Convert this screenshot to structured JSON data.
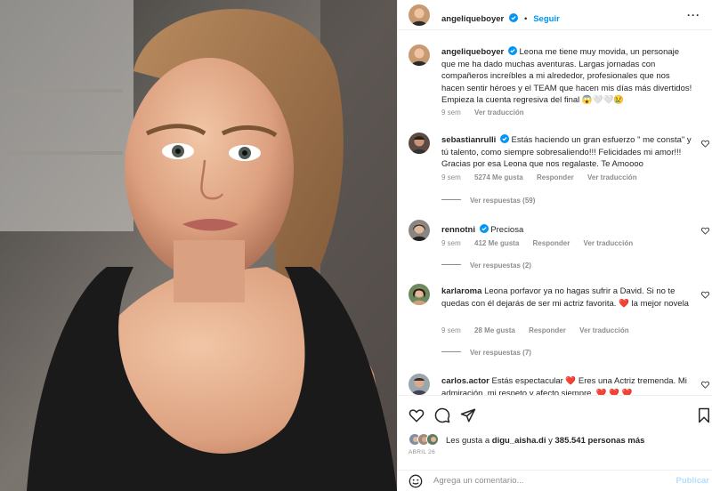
{
  "post": {
    "author": "angeliqueboyer",
    "follow_label": "Seguir",
    "more_icon": "more-dots-icon",
    "photo": "selfie-woman-black-top-braid"
  },
  "caption": {
    "username": "angeliqueboyer",
    "text": "Leona me tiene muy movida, un personaje que me ha dado muchas aventuras. Largas jornadas con compañeros increíbles a mi alrededor, profesionales que nos hacen sentir héroes y el TEAM que hacen mis días más divertidos! Empieza la cuenta regresiva del final 😱🤍🤍😢",
    "time": "9 sem",
    "translate": "Ver traducción"
  },
  "comments": [
    {
      "username": "sebastianrulli",
      "verified": true,
      "text": "Estás haciendo un gran esfuerzo \" me consta\" y tú talento, como siempre sobresaliendo!!! Felicidades mi amor!!! Gracias por esa Leona que nos regalaste. Te Amoooo",
      "time": "9 sem",
      "likes": "5274 Me gusta",
      "reply": "Responder",
      "translate": "Ver traducción",
      "replies": "Ver respuestas (59)"
    },
    {
      "username": "rennotni",
      "verified": true,
      "text": "Preciosa",
      "time": "9 sem",
      "likes": "412 Me gusta",
      "reply": "Responder",
      "translate": "Ver traducción",
      "replies": "Ver respuestas (2)"
    },
    {
      "username": "karlaroma",
      "verified": false,
      "text": "Leona porfavor ya no hagas sufrir a David. Si no te quedas con él dejarás de ser mi actriz favorita. ❤️ la mejor novela",
      "time": "9 sem",
      "likes": "28 Me gusta",
      "reply": "Responder",
      "translate": "Ver traducción",
      "replies": "Ver respuestas (7)"
    },
    {
      "username": "carlos.actor",
      "verified": false,
      "text": "Estás espectacular ❤️ Eres una Actriz tremenda. Mi admiración, mi respeto y afecto siempre. ❤️ ❤️ ❤️",
      "time": "",
      "likes": "",
      "reply": "",
      "translate": "",
      "replies": ""
    }
  ],
  "likes_summary": {
    "prefix": "Les gusta a",
    "user": "digu_aisha.di",
    "middle": "y",
    "count": "385.541 personas más"
  },
  "date": "ABRIL 26",
  "add_comment": {
    "placeholder": "Agrega un comentario...",
    "post_label": "Publicar"
  },
  "colors": {
    "accent": "#0095f6",
    "verified": "#0095f6",
    "muted": "#8e8e8e",
    "post_disabled": "#b2dffc"
  }
}
